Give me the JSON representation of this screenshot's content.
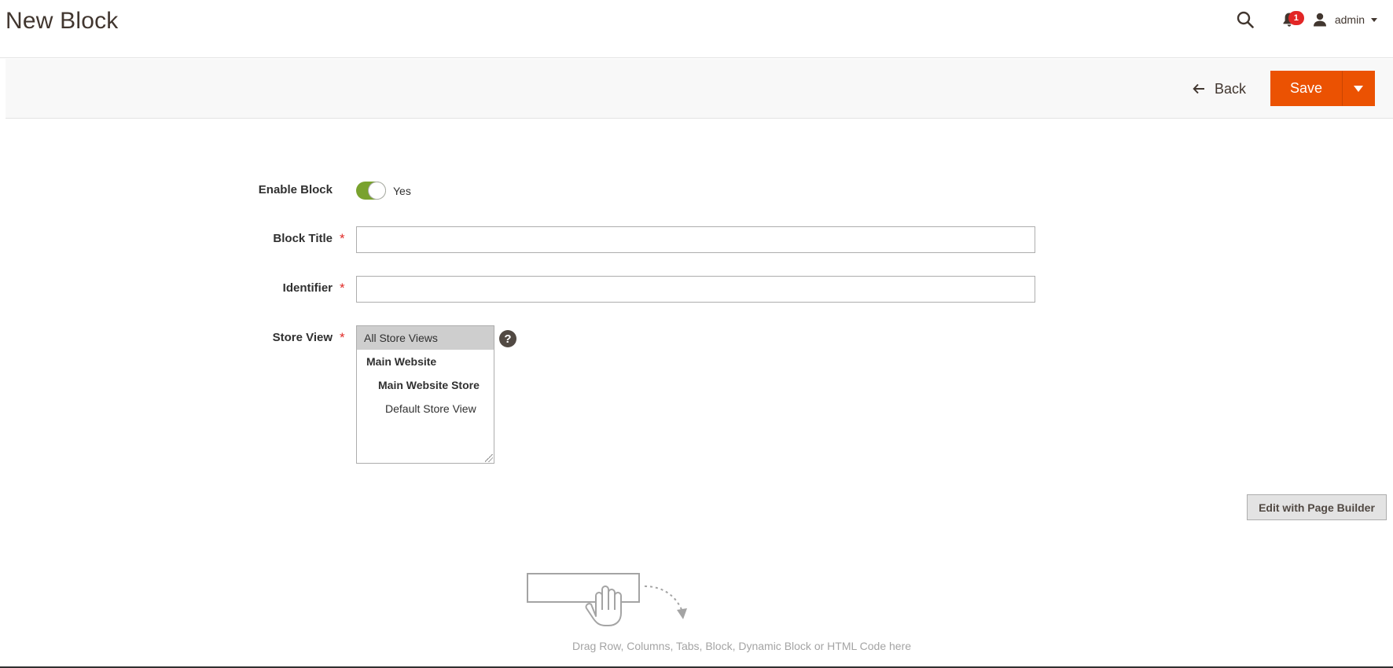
{
  "header": {
    "title": "New Block",
    "notifications_count": "1",
    "user_name": "admin",
    "icons": {
      "search": "search-icon",
      "notifications": "bell-icon",
      "user": "user-icon"
    }
  },
  "action_bar": {
    "back_label": "Back",
    "save_label": "Save"
  },
  "form": {
    "enable_block": {
      "label": "Enable Block",
      "value": "Yes",
      "checked": true
    },
    "block_title": {
      "label": "Block Title",
      "required_mark": "*",
      "value": ""
    },
    "identifier": {
      "label": "Identifier",
      "required_mark": "*",
      "value": ""
    },
    "store_view": {
      "label": "Store View",
      "required_mark": "*",
      "options": [
        "All Store Views",
        "Main Website",
        "Main Website Store",
        "Default Store View"
      ],
      "selected": "All Store Views",
      "help": "?"
    }
  },
  "page_builder": {
    "edit_button_label": "Edit with Page Builder",
    "drop_hint": "Drag Row, Columns, Tabs, Block, Dynamic Block or HTML Code here"
  },
  "colors": {
    "accent": "#eb5202",
    "toggle_on": "#79a22e",
    "required": "#e02b27",
    "badge": "#e22626"
  }
}
